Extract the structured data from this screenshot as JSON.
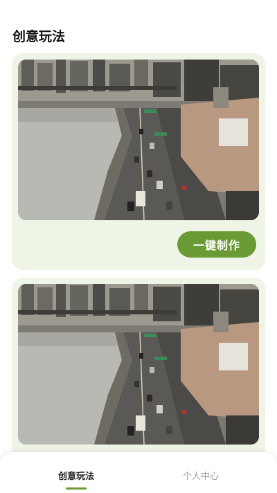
{
  "page": {
    "title": "创意玩法"
  },
  "cards": [
    {
      "image": "city-highway-photo",
      "button_label": "一键制作"
    },
    {
      "image": "city-highway-photo"
    }
  ],
  "tabbar": {
    "tabs": [
      {
        "label": "创意玩法",
        "active": true
      },
      {
        "label": "个人中心",
        "active": false
      }
    ],
    "accent_color": "#6a9a33"
  }
}
